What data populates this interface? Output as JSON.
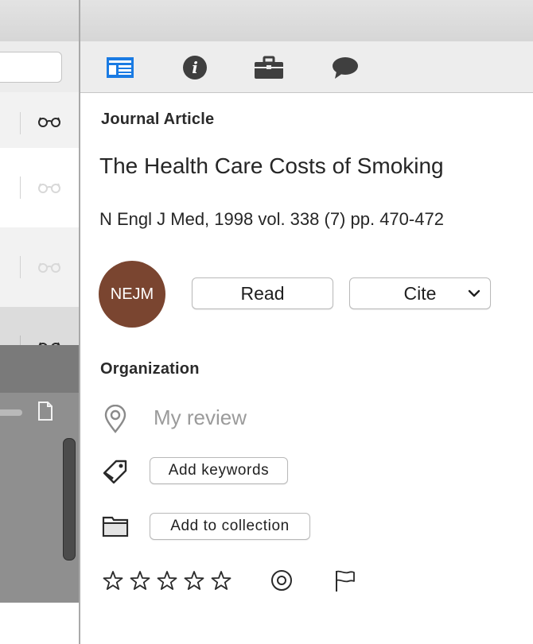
{
  "tabs": [
    {
      "name": "details",
      "icon": "article-layout-icon",
      "active": true
    },
    {
      "name": "info",
      "icon": "info-icon",
      "active": false
    },
    {
      "name": "briefcase",
      "icon": "briefcase-icon",
      "active": false
    },
    {
      "name": "comments",
      "icon": "speech-bubble-icon",
      "active": false
    }
  ],
  "item": {
    "type": "Journal Article",
    "title": "The Health Care Costs of Smoking",
    "citation": "N Engl J Med, 1998 vol. 338 (7) pp. 470-472",
    "journal_badge": "NEJM",
    "journal_badge_color": "#7a4530"
  },
  "actions": {
    "read_label": "Read",
    "cite_label": "Cite"
  },
  "organization": {
    "heading": "Organization",
    "location_text": "My review",
    "add_keywords_label": "Add keywords",
    "add_collection_label": "Add to collection",
    "rating_stars": 0,
    "rating_max": 5
  },
  "colors": {
    "accent": "#1a7be3",
    "icon_dark": "#3f3f3f"
  }
}
